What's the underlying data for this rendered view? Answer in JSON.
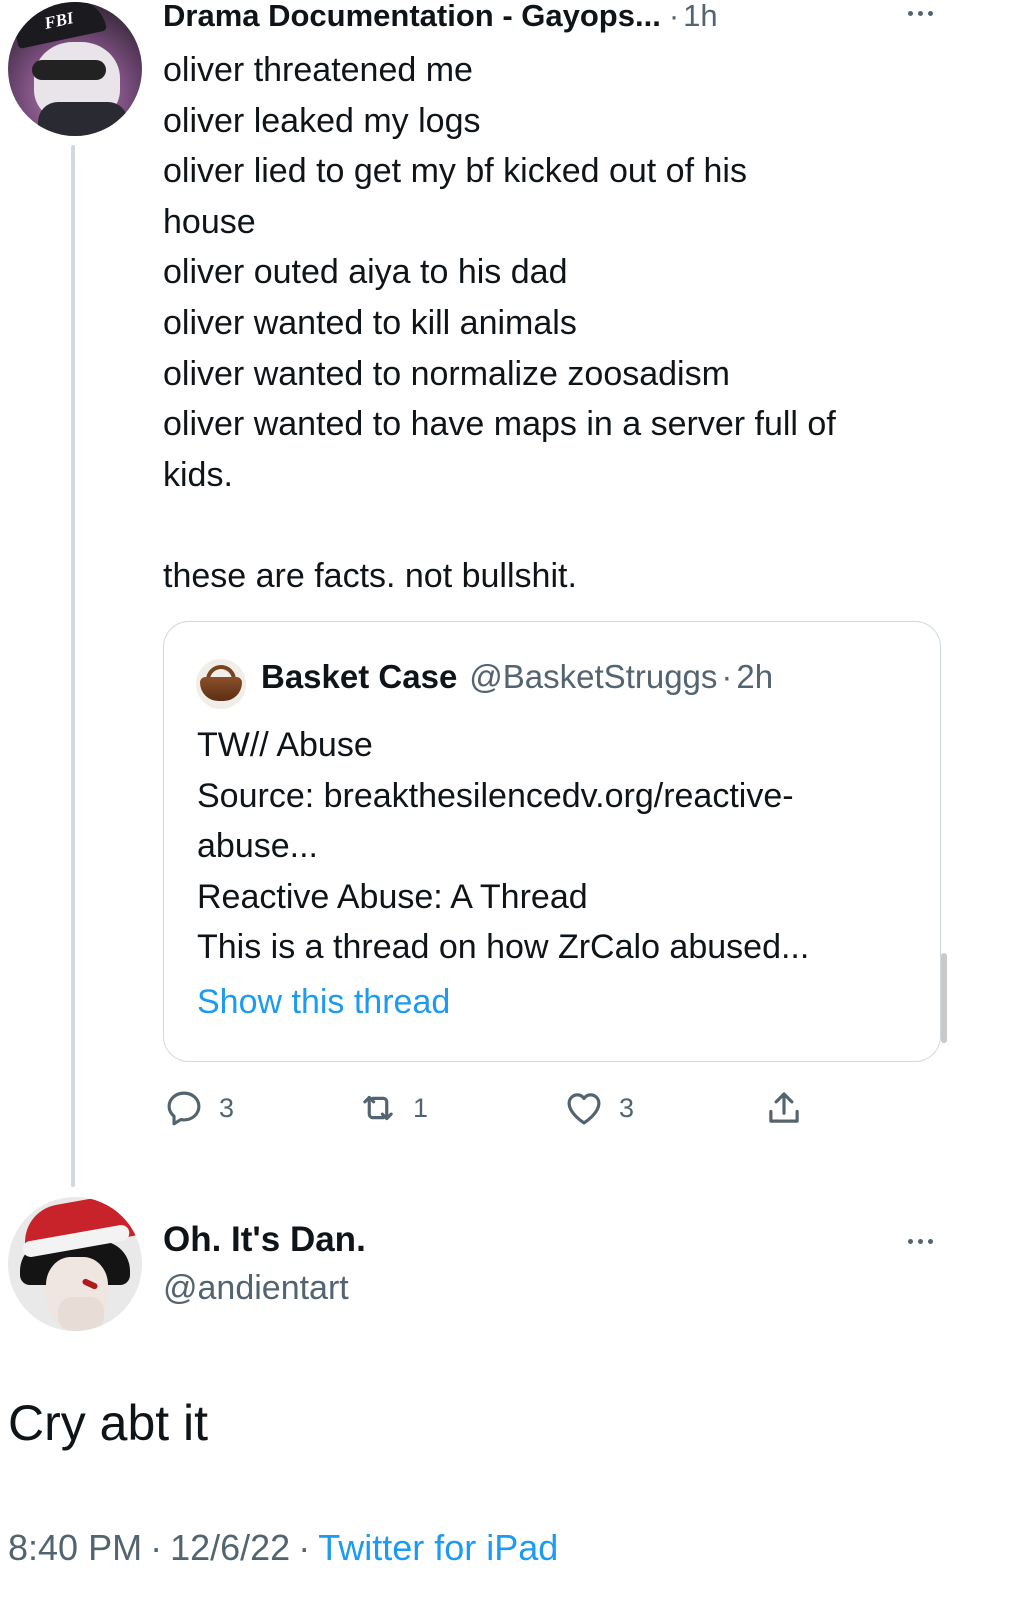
{
  "tweet_main": {
    "display_name": "Drama Documentation - Gayops...",
    "time_sep": "·",
    "time": "1h",
    "lines": [
      "oliver threatened me",
      "oliver leaked my logs",
      "oliver lied to get my bf kicked out of his",
      "house",
      "oliver outed aiya to his dad",
      "oliver wanted to kill animals",
      "oliver wanted to normalize zoosadism",
      "oliver wanted to have maps in a server full of",
      "kids.",
      "these are facts. not bullshit."
    ],
    "avatar_cap_text": "FBI",
    "more_icon": "more-horizontal-icon"
  },
  "quote": {
    "display_name": "Basket Case",
    "handle": "@BasketStruggs",
    "time_sep": "·",
    "time": "2h",
    "lines": [
      "TW// Abuse",
      "Source: breakthesilencedv.org/reactive-",
      "abuse...",
      "Reactive Abuse: A Thread",
      "This is a thread on how ZrCalo abused..."
    ],
    "link_text": "Show this thread"
  },
  "actions": {
    "reply_count": "3",
    "retweet_count": "1",
    "like_count": "3",
    "icons": [
      "reply-icon",
      "retweet-icon",
      "like-icon",
      "share-icon"
    ]
  },
  "tweet_reply": {
    "display_name": "Oh. It's Dan.",
    "handle": "@andientart",
    "text": "Cry abt it",
    "time": "8:40 PM",
    "sep": "·",
    "date": "12/6/22",
    "source": "Twitter for iPad"
  },
  "colors": {
    "text": "#0f1419",
    "secondary": "#536471",
    "link": "#1d9bf0",
    "border": "#cfd9de"
  }
}
